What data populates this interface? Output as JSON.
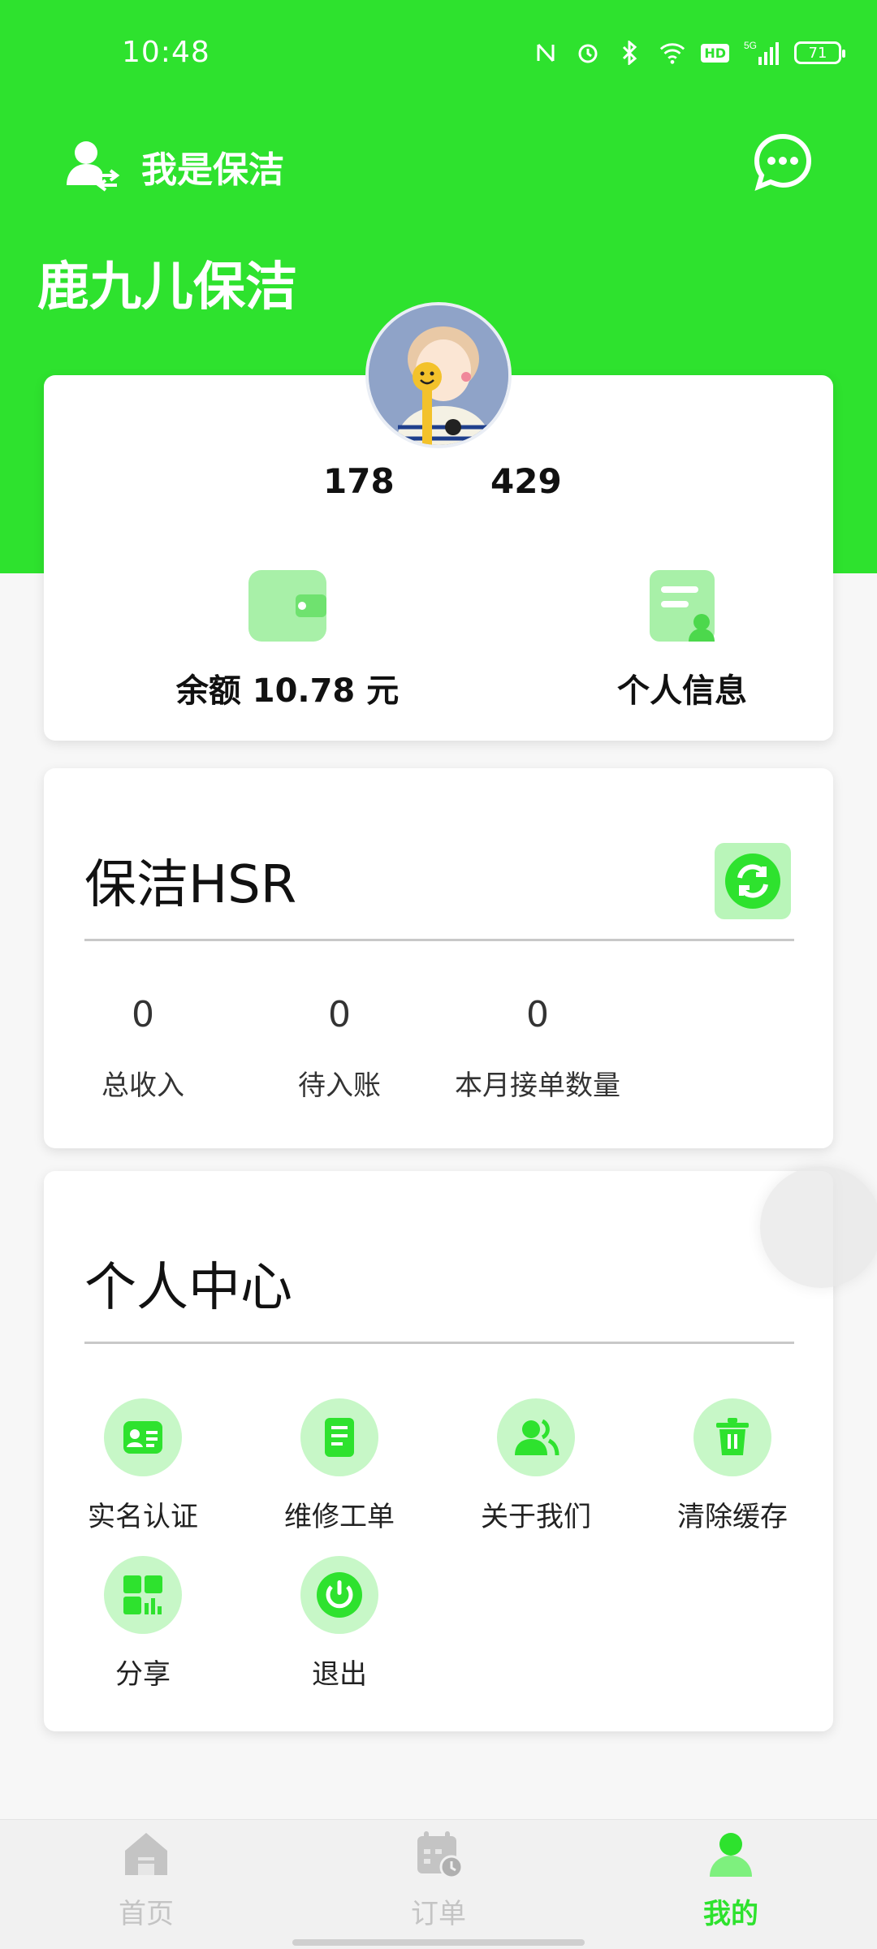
{
  "status_bar": {
    "time": "10:48",
    "battery": "71",
    "network": "5G",
    "hd": "HD"
  },
  "header": {
    "role_label": "我是保洁",
    "shop_name": "鹿九儿保洁"
  },
  "profile": {
    "stat_left": "178",
    "stat_right": "429",
    "balance_prefix": "余额",
    "balance_value": "10.78",
    "balance_unit": "元",
    "personal_info_label": "个人信息"
  },
  "hsr": {
    "title": "保洁HSR",
    "stats": [
      {
        "value": "0",
        "label": "总收入"
      },
      {
        "value": "0",
        "label": "待入账"
      },
      {
        "value": "0",
        "label": "本月接单数量"
      }
    ]
  },
  "center": {
    "title": "个人中心",
    "items": [
      {
        "label": "实名认证",
        "icon": "id-card-icon"
      },
      {
        "label": "维修工单",
        "icon": "document-icon"
      },
      {
        "label": "关于我们",
        "icon": "users-icon"
      },
      {
        "label": "清除缓存",
        "icon": "trash-icon"
      },
      {
        "label": "分享",
        "icon": "share-grid-icon"
      },
      {
        "label": "退出",
        "icon": "power-icon"
      }
    ]
  },
  "nav": {
    "items": [
      {
        "label": "首页",
        "icon": "home-icon",
        "active": false
      },
      {
        "label": "订单",
        "icon": "calendar-icon",
        "active": false
      },
      {
        "label": "我的",
        "icon": "user-icon",
        "active": true
      }
    ]
  },
  "colors": {
    "accent": "#2ee22e",
    "accent_light": "#c7f7c7"
  }
}
